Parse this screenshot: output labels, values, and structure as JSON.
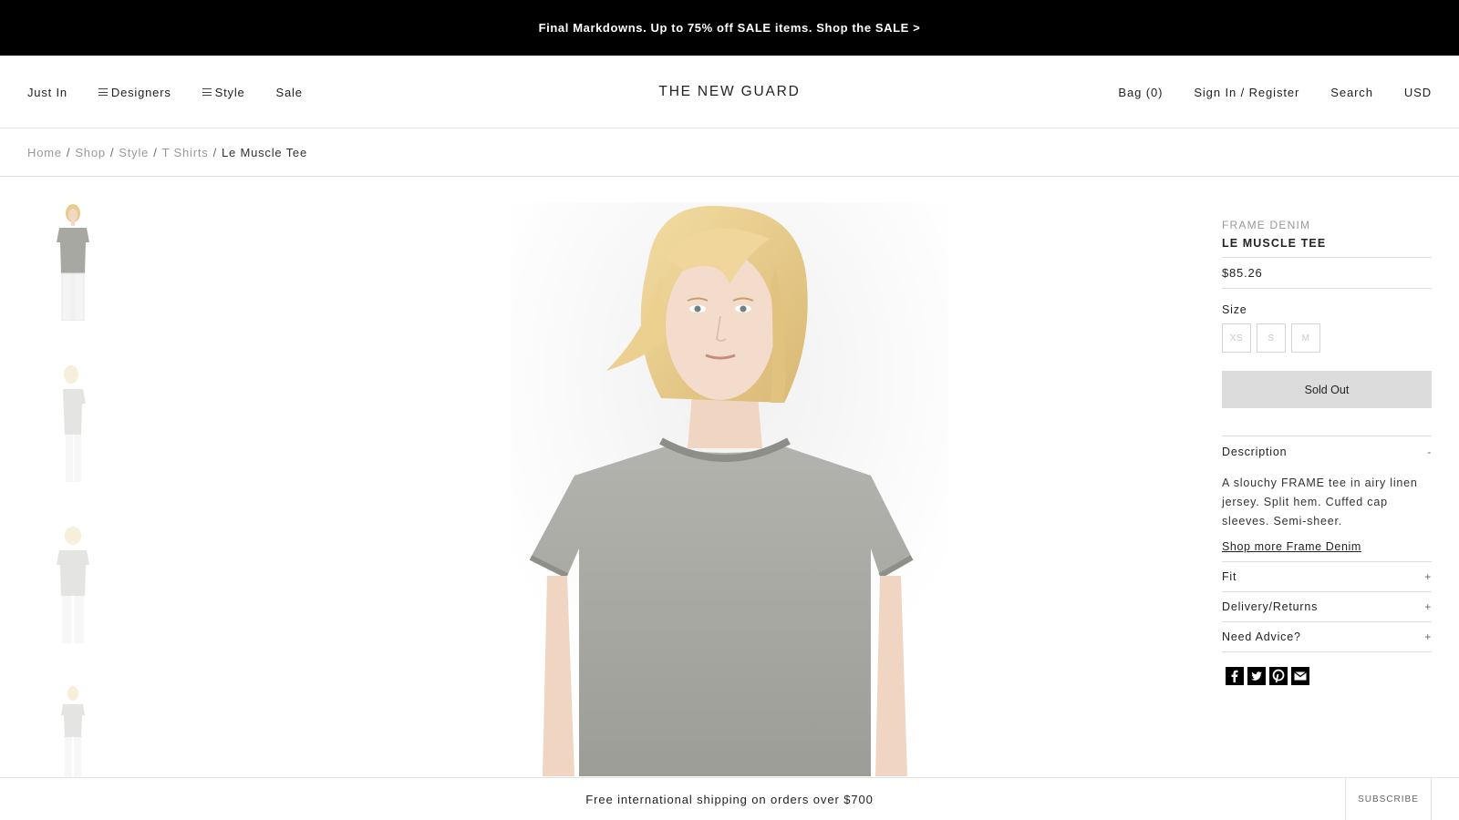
{
  "promo": {
    "text": "Final Markdowns. Up to 75% off SALE items. Shop the SALE >"
  },
  "nav": {
    "left": [
      {
        "label": "Just In",
        "menu": false
      },
      {
        "label": "Designers",
        "menu": true
      },
      {
        "label": "Style",
        "menu": true
      },
      {
        "label": "Sale",
        "menu": false
      }
    ],
    "brand": "THE NEW GUARD",
    "right": [
      "Bag (0)",
      "Sign In / Register",
      "Search",
      "USD"
    ]
  },
  "breadcrumb": {
    "items": [
      "Home",
      "Shop",
      "Style",
      "T Shirts"
    ],
    "separator": "/",
    "current": "Le Muscle Tee"
  },
  "product": {
    "brand": "FRAME DENIM",
    "name": "LE MUSCLE TEE",
    "price": "$85.26",
    "size_label": "Size",
    "sizes": [
      "XS",
      "S",
      "M"
    ],
    "button_label": "Sold Out",
    "accordion": {
      "description_label": "Description",
      "description_toggle": "-",
      "description_text": "A slouchy FRAME tee in airy linen jersey. Split hem. Cuffed cap sleeves. Semi-sheer.",
      "shop_more": "Shop more Frame Denim",
      "fit_label": "Fit",
      "delivery_label": "Delivery/Returns",
      "advice_label": "Need Advice?",
      "collapsed_toggle": "+"
    },
    "social_icons": [
      "facebook-icon",
      "twitter-icon",
      "pinterest-icon",
      "email-icon"
    ]
  },
  "footer": {
    "shipping_text": "Free international shipping on orders over $700",
    "subscribe_label": "SUBSCRIBE"
  },
  "colors": {
    "promo_bg": "#000000",
    "sold_out_bg": "#dcdcdc",
    "shirt": "#a8a8a2",
    "hair": "#e8cc8e"
  }
}
